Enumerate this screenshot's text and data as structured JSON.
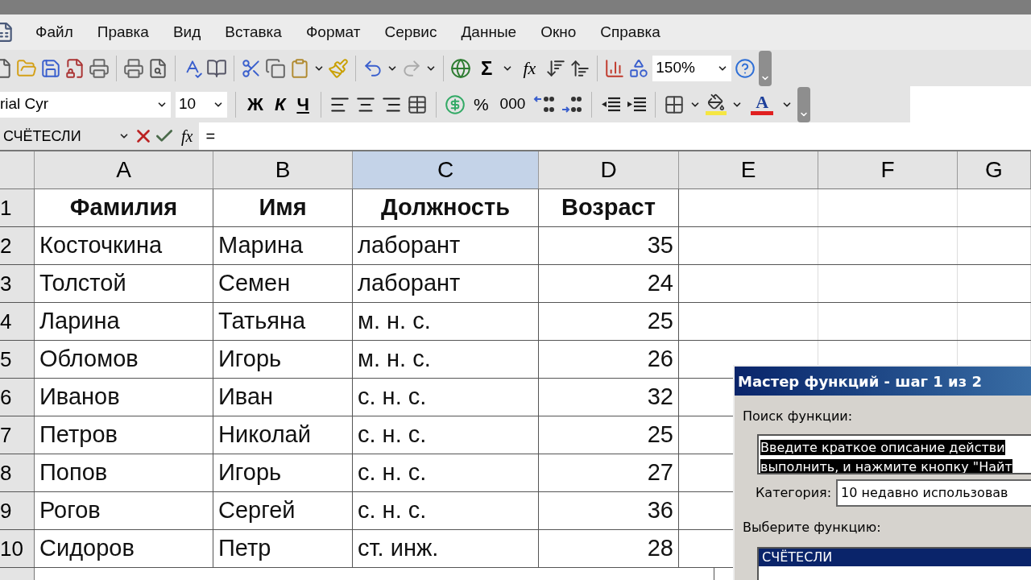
{
  "menu": [
    {
      "label": "Файл"
    },
    {
      "label": "Правка"
    },
    {
      "label": "Вид"
    },
    {
      "label": "Вставка"
    },
    {
      "label": "Формат"
    },
    {
      "label": "Сервис"
    },
    {
      "label": "Данные"
    },
    {
      "label": "Окно"
    },
    {
      "label": "Справка"
    }
  ],
  "standard_toolbar": {
    "sum": "Σ",
    "function": "fx",
    "zoom": "150%"
  },
  "formatting_toolbar": {
    "font": "rial Cyr",
    "size": "10",
    "bold": "Ж",
    "italic": "К",
    "underline": "Ч",
    "percent": "%",
    "thousands": "000",
    "font_color": "A"
  },
  "formula_bar": {
    "name_box": "СЧЁТЕСЛИ",
    "function": "fx",
    "content": "="
  },
  "columns": [
    {
      "label": "A",
      "selected": false
    },
    {
      "label": "B",
      "selected": false
    },
    {
      "label": "C",
      "selected": true
    },
    {
      "label": "D",
      "selected": false
    },
    {
      "label": "E",
      "selected": false
    },
    {
      "label": "F",
      "selected": false
    },
    {
      "label": "G",
      "selected": false
    }
  ],
  "rows": [
    {
      "number": "1",
      "cells": [
        "Фамилия",
        "Имя",
        "Должность",
        "Возраст"
      ],
      "kind": "header"
    },
    {
      "number": "2",
      "cells": [
        "Косточкина",
        "Марина",
        "лаборант",
        "35"
      ],
      "kind": "data"
    },
    {
      "number": "3",
      "cells": [
        "Толстой",
        "Семен",
        "лаборант",
        "24"
      ],
      "kind": "data"
    },
    {
      "number": "4",
      "cells": [
        "Ларина",
        "Татьяна",
        "м. н. с.",
        "25"
      ],
      "kind": "data"
    },
    {
      "number": "5",
      "cells": [
        "Обломов",
        "Игорь",
        "м. н. с.",
        "26"
      ],
      "kind": "data"
    },
    {
      "number": "6",
      "cells": [
        "Иванов",
        "Иван",
        "с. н. с.",
        "32"
      ],
      "kind": "data"
    },
    {
      "number": "7",
      "cells": [
        "Петров",
        "Николай",
        "с. н. с.",
        "25"
      ],
      "kind": "data"
    },
    {
      "number": "8",
      "cells": [
        "Попов",
        "Игорь",
        "с. н. с.",
        "27"
      ],
      "kind": "data"
    },
    {
      "number": "9",
      "cells": [
        "Рогов",
        "Сергей",
        "с. н. с.",
        "36"
      ],
      "kind": "data"
    },
    {
      "number": "10",
      "cells": [
        "Сидоров",
        "Петр",
        "ст. инж.",
        "28"
      ],
      "kind": "data"
    }
  ],
  "dialog": {
    "title": "Мастер функций - шаг 1 из 2",
    "search_label": "Поиск функции:",
    "search_lines": [
      "Введите краткое описание действи",
      "выполнить, и нажмите кнопку \"Найт"
    ],
    "category_label": "Категория:",
    "category_value": "10 недавно использовав",
    "list_label": "Выберите функцию:",
    "functions": [
      {
        "name": "СЧЁТЕСЛИ",
        "selected": true
      }
    ]
  }
}
